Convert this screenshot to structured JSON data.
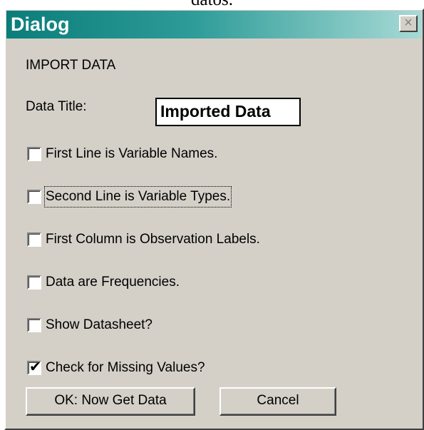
{
  "caption": "datos.",
  "window": {
    "title": "Dialog",
    "close_icon": "×"
  },
  "dialog": {
    "heading": "IMPORT DATA",
    "data_title_label": "Data Title:",
    "data_title_value": "Imported Data",
    "checkboxes": [
      {
        "label": "First Line is Variable Names.",
        "checked": false
      },
      {
        "label": "Second Line is Variable Types.",
        "checked": false,
        "focused": true
      },
      {
        "label": "First Column is Observation Labels.",
        "checked": false
      },
      {
        "label": "Data are Frequencies.",
        "checked": false
      },
      {
        "label": "Show Datasheet?",
        "checked": false
      },
      {
        "label": "Check for Missing Values?",
        "checked": true
      }
    ],
    "ok_label": "OK: Now Get Data",
    "cancel_label": "Cancel"
  }
}
